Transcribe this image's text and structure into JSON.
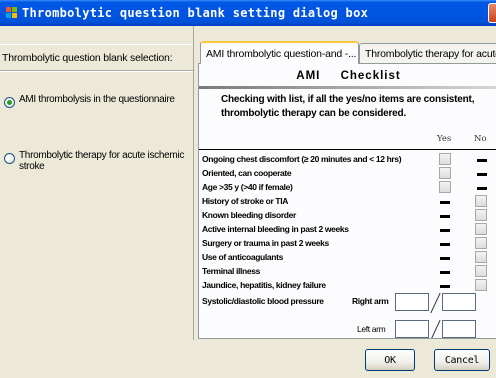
{
  "window": {
    "title": "Thrombolytic question blank setting dialog box"
  },
  "left": {
    "header": "Thrombolytic question blank selection:",
    "options": [
      {
        "label": "AMI thrombolysis in the questionnaire",
        "checked": true
      },
      {
        "label": "Thrombolytic therapy for acute ischemic stroke",
        "checked": false
      }
    ]
  },
  "tabs": [
    {
      "label": "AMI thrombolytic question-and -...",
      "active": true
    },
    {
      "label": "Thrombolytic therapy for acute i...",
      "active": false
    }
  ],
  "checklist": {
    "title_left": "AMI",
    "title_right": "Checklist",
    "instruction": "Checking with list, if all the yes/no items are consistent, thrombolytic therapy can be considered.",
    "col_yes": "Yes",
    "col_no": "No",
    "items": [
      {
        "label": "Ongoing chest discomfort (≥ 20 minutes and < 12 hrs)",
        "yes": "box",
        "no": "dash"
      },
      {
        "label": "Oriented, can cooperate",
        "yes": "box",
        "no": "dash"
      },
      {
        "label": "Age >35 y (>40 if female)",
        "yes": "box",
        "no": "dash"
      },
      {
        "label": "History of stroke or TIA",
        "yes": "dash",
        "no": "box"
      },
      {
        "label": "Known bleeding disorder",
        "yes": "dash",
        "no": "box"
      },
      {
        "label": "Active internal bleeding in past 2 weeks",
        "yes": "dash",
        "no": "box"
      },
      {
        "label": "Surgery or trauma in past 2 weeks",
        "yes": "dash",
        "no": "box"
      },
      {
        "label": "Use of anticoagulants",
        "yes": "dash",
        "no": "box"
      },
      {
        "label": "Terminal illness",
        "yes": "dash",
        "no": "box"
      },
      {
        "label": "Jaundice, hepatitis, kidney failure",
        "yes": "dash",
        "no": "box"
      }
    ],
    "bp_label": "Systolic/diastolic blood pressure",
    "right_arm": "Right arm",
    "left_arm": "Left arm"
  },
  "buttons": {
    "ok": "OK",
    "cancel": "Cancel"
  }
}
